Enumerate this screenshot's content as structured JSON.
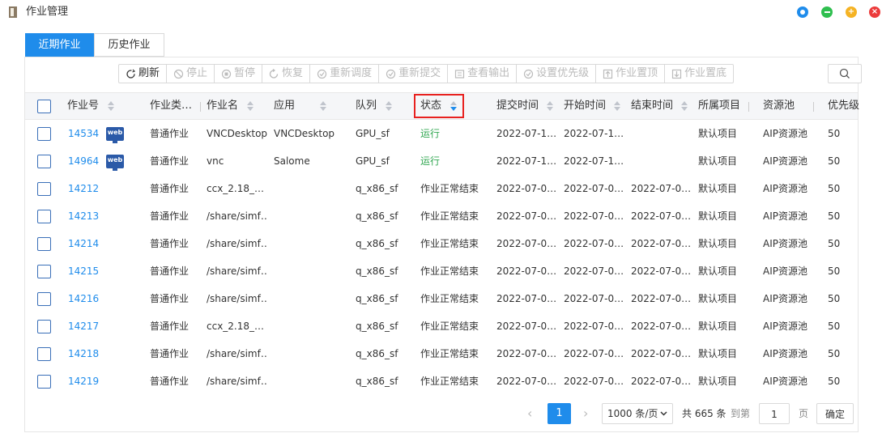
{
  "window": {
    "title": "作业管理",
    "btn_colors": {
      "info": "#1f8ceb",
      "min": "#2fbf4f",
      "max": "#f5b324",
      "close": "#ec3b3b"
    }
  },
  "tabs": [
    {
      "label": "近期作业",
      "active": true
    },
    {
      "label": "历史作业",
      "active": false
    }
  ],
  "toolbar": {
    "buttons": [
      {
        "label": "刷新",
        "icon": "refresh-icon",
        "enabled": true
      },
      {
        "label": "停止",
        "icon": "stop-icon",
        "enabled": false
      },
      {
        "label": "暂停",
        "icon": "pause-icon",
        "enabled": false
      },
      {
        "label": "恢复",
        "icon": "resume-icon",
        "enabled": false
      },
      {
        "label": "重新调度",
        "icon": "reschedule-icon",
        "enabled": false
      },
      {
        "label": "重新提交",
        "icon": "resubmit-icon",
        "enabled": false
      },
      {
        "label": "查看输出",
        "icon": "view-output-icon",
        "enabled": false
      },
      {
        "label": "设置优先级",
        "icon": "priority-icon",
        "enabled": false
      },
      {
        "label": "作业置顶",
        "icon": "pin-top-icon",
        "enabled": false
      },
      {
        "label": "作业置底",
        "icon": "pin-bottom-icon",
        "enabled": false
      }
    ],
    "search_icon": "search-icon"
  },
  "table": {
    "headers": [
      "作业号",
      "作业类…",
      "作业名",
      "应用",
      "队列",
      "状态",
      "提交时间",
      "开始时间",
      "结束时间",
      "所属项目",
      "资源池",
      "优先级"
    ],
    "sorted_column": "状态",
    "rows": [
      {
        "id": "14534",
        "web": true,
        "type": "普通作业",
        "name": "VNCDesktop",
        "app": "VNCDesktop",
        "queue": "GPU_sf",
        "status": "运行",
        "running": true,
        "submit": "2022-07-1…",
        "start": "2022-07-1…",
        "end": "",
        "project": "默认项目",
        "pool": "AIP资源池",
        "priority": "50"
      },
      {
        "id": "14964",
        "web": true,
        "type": "普通作业",
        "name": "vnc",
        "app": "Salome",
        "queue": "GPU_sf",
        "status": "运行",
        "running": true,
        "submit": "2022-07-1…",
        "start": "2022-07-1…",
        "end": "",
        "project": "默认项目",
        "pool": "AIP资源池",
        "priority": "50"
      },
      {
        "id": "14212",
        "web": false,
        "type": "普通作业",
        "name": "ccx_2.18_…",
        "app": "",
        "queue": "q_x86_sf",
        "status": "作业正常结束",
        "running": false,
        "submit": "2022-07-0…",
        "start": "2022-07-0…",
        "end": "2022-07-0…",
        "project": "默认项目",
        "pool": "AIP资源池",
        "priority": "50"
      },
      {
        "id": "14213",
        "web": false,
        "type": "普通作业",
        "name": "/share/simf…",
        "app": "",
        "queue": "q_x86_sf",
        "status": "作业正常结束",
        "running": false,
        "submit": "2022-07-0…",
        "start": "2022-07-0…",
        "end": "2022-07-0…",
        "project": "默认项目",
        "pool": "AIP资源池",
        "priority": "50"
      },
      {
        "id": "14214",
        "web": false,
        "type": "普通作业",
        "name": "/share/simf…",
        "app": "",
        "queue": "q_x86_sf",
        "status": "作业正常结束",
        "running": false,
        "submit": "2022-07-0…",
        "start": "2022-07-0…",
        "end": "2022-07-0…",
        "project": "默认项目",
        "pool": "AIP资源池",
        "priority": "50"
      },
      {
        "id": "14215",
        "web": false,
        "type": "普通作业",
        "name": "/share/simf…",
        "app": "",
        "queue": "q_x86_sf",
        "status": "作业正常结束",
        "running": false,
        "submit": "2022-07-0…",
        "start": "2022-07-0…",
        "end": "2022-07-0…",
        "project": "默认项目",
        "pool": "AIP资源池",
        "priority": "50"
      },
      {
        "id": "14216",
        "web": false,
        "type": "普通作业",
        "name": "/share/simf…",
        "app": "",
        "queue": "q_x86_sf",
        "status": "作业正常结束",
        "running": false,
        "submit": "2022-07-0…",
        "start": "2022-07-0…",
        "end": "2022-07-0…",
        "project": "默认项目",
        "pool": "AIP资源池",
        "priority": "50"
      },
      {
        "id": "14217",
        "web": false,
        "type": "普通作业",
        "name": "ccx_2.18_…",
        "app": "",
        "queue": "q_x86_sf",
        "status": "作业正常结束",
        "running": false,
        "submit": "2022-07-0…",
        "start": "2022-07-0…",
        "end": "2022-07-0…",
        "project": "默认项目",
        "pool": "AIP资源池",
        "priority": "50"
      },
      {
        "id": "14218",
        "web": false,
        "type": "普通作业",
        "name": "/share/simf…",
        "app": "",
        "queue": "q_x86_sf",
        "status": "作业正常结束",
        "running": false,
        "submit": "2022-07-0…",
        "start": "2022-07-0…",
        "end": "2022-07-0…",
        "project": "默认项目",
        "pool": "AIP资源池",
        "priority": "50"
      },
      {
        "id": "14219",
        "web": false,
        "type": "普通作业",
        "name": "/share/simf…",
        "app": "",
        "queue": "q_x86_sf",
        "status": "作业正常结束",
        "running": false,
        "submit": "2022-07-0…",
        "start": "2022-07-0…",
        "end": "2022-07-0…",
        "project": "默认项目",
        "pool": "AIP资源池",
        "priority": "50"
      }
    ],
    "web_badge_label": "web"
  },
  "pagination": {
    "prev": "‹",
    "current_page": "1",
    "next": "›",
    "page_size": "1000 条/页",
    "total": "共 665 条",
    "goto_label": "到第",
    "goto_value": "1",
    "page_suffix": "页",
    "confirm": "确定"
  },
  "colors": {
    "accent": "#1f8ceb",
    "running": "#33a853",
    "highlight": "#e8211f"
  }
}
